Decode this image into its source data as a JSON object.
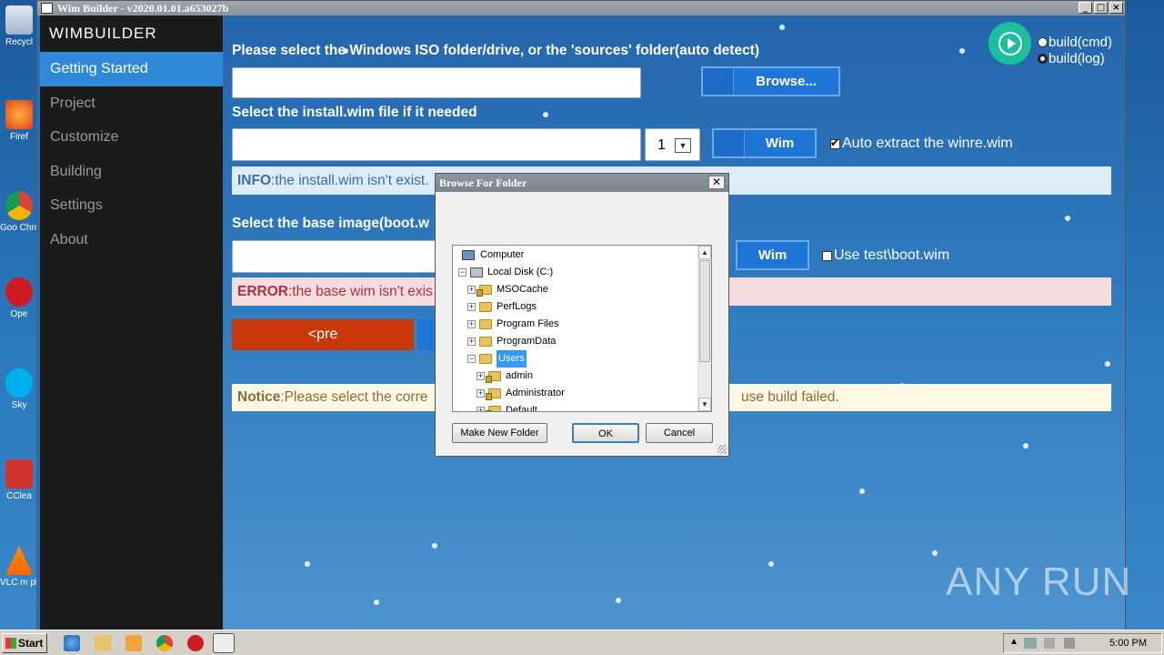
{
  "window": {
    "title": "Wim Builder - v2020.01.01.a653027b"
  },
  "desktop_icons": [
    "Recycl",
    "Firef",
    "Goo Chro",
    "Ope",
    "Sky",
    "CClea",
    "VLC m play"
  ],
  "sidebar": {
    "brand": "WIMBUILDER",
    "items": [
      {
        "label": "Getting Started",
        "active": true
      },
      {
        "label": "Project"
      },
      {
        "label": "Customize"
      },
      {
        "label": "Building"
      },
      {
        "label": "Settings"
      },
      {
        "label": "About"
      }
    ]
  },
  "main": {
    "iso_label": "Please select the Windows ISO folder/drive, or the 'sources' folder(auto detect)",
    "browse_label": "Browse...",
    "install_label": "Select the install.wim file if it needed",
    "index_value": "1",
    "wim_label": "Wim",
    "auto_extract_label": "Auto extract the winre.wim",
    "info_prefix": "INFO",
    "info_text": ":the install.wim isn't exist.",
    "base_label": "Select the base image(boot.w",
    "wim2_label": "Wim",
    "use_test_label": "Use test\\boot.wim",
    "error_prefix": "ERROR",
    "error_text": ":the base wim isn't exis",
    "pre_label": "<pre",
    "notice_prefix": "Notice",
    "notice_text": ":Please select the corre",
    "notice_tail": "use build failed.",
    "build_cmd": "build(cmd)",
    "build_log": "build(log)"
  },
  "dialog": {
    "title": "Browse For Folder",
    "tree": [
      {
        "label": "Computer",
        "level": 0
      },
      {
        "label": "Local Disk (C:)",
        "level": 1,
        "expander": "−"
      },
      {
        "label": "MSOCache",
        "level": 2,
        "expander": "+",
        "locked": true
      },
      {
        "label": "PerfLogs",
        "level": 2,
        "expander": "+"
      },
      {
        "label": "Program Files",
        "level": 2,
        "expander": "+"
      },
      {
        "label": "ProgramData",
        "level": 2,
        "expander": "+"
      },
      {
        "label": "Users",
        "level": 2,
        "expander": "−",
        "selected": true
      },
      {
        "label": "admin",
        "level": 3,
        "expander": "+",
        "locked": true
      },
      {
        "label": "Administrator",
        "level": 3,
        "expander": "+",
        "locked": true
      },
      {
        "label": "Default",
        "level": 3,
        "expander": "+",
        "locked": true
      }
    ],
    "make_folder": "Make New Folder",
    "ok": "OK",
    "cancel": "Cancel"
  },
  "taskbar": {
    "start": "Start",
    "clock": "5:00 PM"
  },
  "watermark": "ANY RUN",
  "colors": {
    "accent": "#2e8ad8",
    "pre_button": "#c8380a",
    "error_bg": "#f5dddf",
    "info_bg": "#dcecf8",
    "notice_bg": "#fdf8e3"
  }
}
